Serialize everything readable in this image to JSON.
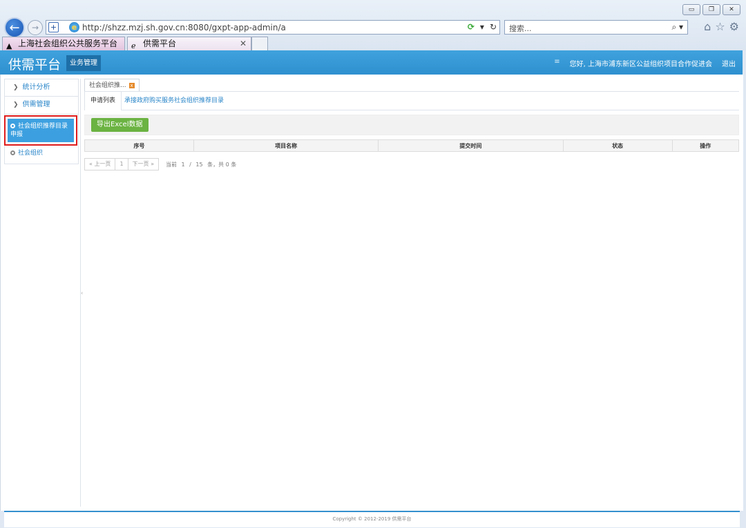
{
  "browser": {
    "url": "http://shzz.mzj.sh.gov.cn:8080/gxpt-app-admin/a",
    "search_placeholder": "搜索...",
    "tabs": [
      {
        "label": "上海社会组织公共服务平台"
      },
      {
        "label": "供需平台"
      }
    ]
  },
  "header": {
    "logo": "供需平台",
    "nav_item": "业务管理",
    "welcome": "您好, 上海市浦东新区公益组织项目合作促进会",
    "logout": "退出"
  },
  "sidebar": {
    "groups": [
      {
        "label": "统计分析"
      },
      {
        "label": "供需管理"
      }
    ],
    "items": [
      {
        "label": "社会组织推荐目录申报",
        "active": true
      },
      {
        "label": "社会组织",
        "active": false
      }
    ]
  },
  "page_tab": {
    "label": "社会组织推..."
  },
  "sub_tabs": [
    {
      "label": "申请列表"
    },
    {
      "label": "承接政府购买服务社会组织推荐目录"
    }
  ],
  "toolbar": {
    "export_label": "导出Excel数据"
  },
  "table": {
    "columns": [
      "序号",
      "项目名称",
      "提交时间",
      "状态",
      "操作"
    ]
  },
  "pager": {
    "prev": "« 上一页",
    "current_page_btn": "1",
    "next": "下一页 »",
    "current_label": "当前",
    "page": "1",
    "slash": "/",
    "page_size": "15",
    "summary": "条，共 0 条"
  },
  "footer": {
    "copyright": "Copyright © 2012-2019 供需平台"
  },
  "colors": {
    "header_bg": "#3fa2dd",
    "accent": "#2a86c9",
    "export_btn": "#6bb342",
    "highlight_box": "#e01b1b"
  }
}
